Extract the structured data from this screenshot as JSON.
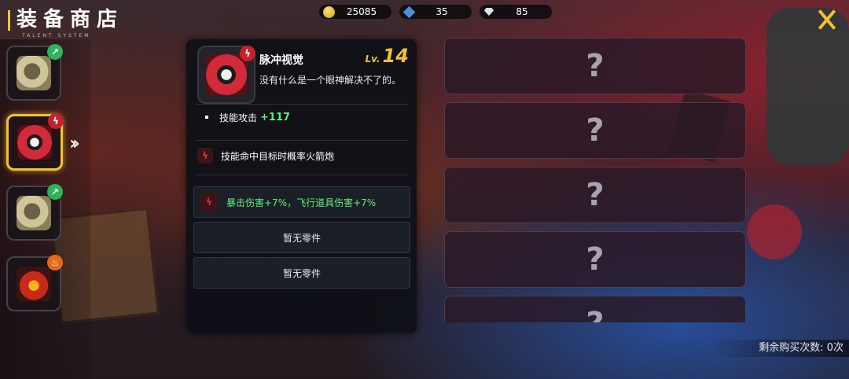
{
  "header": {
    "title": "装备商店",
    "subtitle": "TALENT SYSTEM"
  },
  "currency": {
    "gold": "25085",
    "crystal": "35",
    "diamond": "85"
  },
  "inventory": [
    {
      "icon": "khaki-backpack-icon",
      "badge": "upgrade-arrow-icon"
    },
    {
      "icon": "red-visor-icon",
      "badge": "pulse-icon",
      "selected": true
    },
    {
      "icon": "khaki-gauntlet-icon",
      "badge": "upgrade-arrow-icon"
    },
    {
      "icon": "fire-core-icon",
      "badge": "flame-icon"
    }
  ],
  "detail": {
    "name": "脉冲视觉",
    "level_label": "Lv.",
    "level": "14",
    "description": "没有什么是一个眼神解决不了的。",
    "stat_label": "技能攻击",
    "stat_value": "+117",
    "effect": "技能命中目标时概率火箭炮",
    "parts": [
      {
        "text": "暴击伤害+7%，飞行道具伤害+7%",
        "active": true
      },
      {
        "text": "暂无零件",
        "active": false
      },
      {
        "text": "暂无零件",
        "active": false
      }
    ]
  },
  "shop_slots": [
    "?",
    "?",
    "?",
    "?",
    "?"
  ],
  "footer": {
    "remaining_label": "剩余购买次数: 0次"
  },
  "colors": {
    "accent": "#f2c230",
    "positive": "#5ef07a",
    "panel": "#0e1016"
  }
}
